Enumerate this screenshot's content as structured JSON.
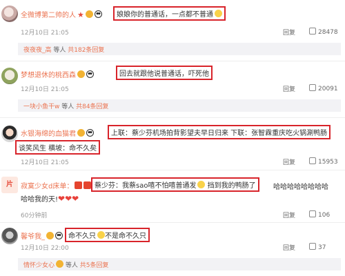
{
  "comments": [
    {
      "username": "全微博第二帅的人",
      "text": "娘娘你的普通话，一点都不普通",
      "time": "12月10日 21:05",
      "reply_label": "回复",
      "likes": "28478",
      "sub": {
        "name": "夜夜夜_高",
        "mid": " 等人 ",
        "count": "共182条回复"
      }
    },
    {
      "username": "梦想退休的桃西森",
      "text": "回去就跟他说普通话，吓死他",
      "time": "12月10日 21:05",
      "reply_label": "回复",
      "likes": "20091",
      "sub": {
        "name": "一块小鱼干w",
        "mid": " 等人 ",
        "count": "共84条回复"
      }
    },
    {
      "username": "水银海绵的血猫君",
      "text_line1": "上联：蔡少芬机场拍背影望夫早日归来  下联：张智霖重庆吃火锅涮鸭肠",
      "text_line2": "谈笑风生  横坡：命不久矣",
      "time": "12月10日 21:05",
      "reply_label": "回复",
      "likes": "15953"
    },
    {
      "username": "寂寞少女d床单：",
      "text_line1_boxed": "蔡少芬：我蔡sao嘻不怕嘻普通发",
      "text_line1_boxed_b": " 挡到我的鸭肠了",
      "text_line1_tail": "哈哈哈哈哈哈哈哈",
      "text_line2": "哈哈我的天!",
      "time": "60分钟前",
      "reply_label": "回复",
      "likes": "106"
    },
    {
      "username": "馨爷我_",
      "text_a": "命不久只",
      "text_b": "不是命不久只",
      "time": "12月10日 22:00",
      "reply_label": "回复",
      "likes": "37",
      "sub": {
        "name": "情怀少女心",
        "mid": " 等人 ",
        "count": "共5条回复"
      }
    }
  ],
  "colors": {
    "accent": "#eb7350",
    "highlight_border": "#d8232a",
    "meta": "#999999"
  }
}
